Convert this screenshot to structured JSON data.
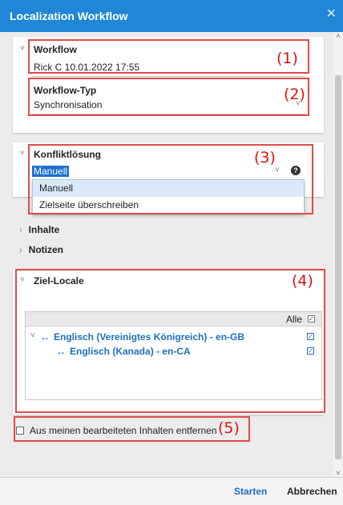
{
  "window": {
    "title": "Localization Workflow",
    "close_icon": "close-icon"
  },
  "workflow": {
    "label": "Workflow",
    "value": "Rick C 10.01.2022 17:55"
  },
  "workflow_type": {
    "label": "Workflow-Typ",
    "value": "Synchronisation"
  },
  "conflict": {
    "label": "Konfliktlösung",
    "value": "Manuell",
    "help_icon": "help-icon",
    "options": [
      "Manuell",
      "Zielseite überschreiben"
    ]
  },
  "sections": {
    "contents": "Inhalte",
    "notes": "Notizen"
  },
  "target_locales": {
    "label": "Ziel-Locale",
    "all_label": "Alle",
    "items": [
      {
        "label": "Englisch (Vereinigtes Königreich) - en-GB",
        "checked": true
      },
      {
        "label": "Englisch (Kanada) - en-CA",
        "checked": true
      }
    ]
  },
  "remove_option": {
    "label": "Aus meinen bearbeiteten Inhalten entfernen",
    "checked": false
  },
  "footer": {
    "start": "Starten",
    "cancel": "Abbrechen"
  },
  "annotations": [
    "(1)",
    "(2)",
    "(3)",
    "(4)",
    "(5)"
  ],
  "colors": {
    "titlebar": "#1f87d6",
    "accent_blue": "#1f6fbf",
    "annotation_red": "#e24a4a"
  }
}
